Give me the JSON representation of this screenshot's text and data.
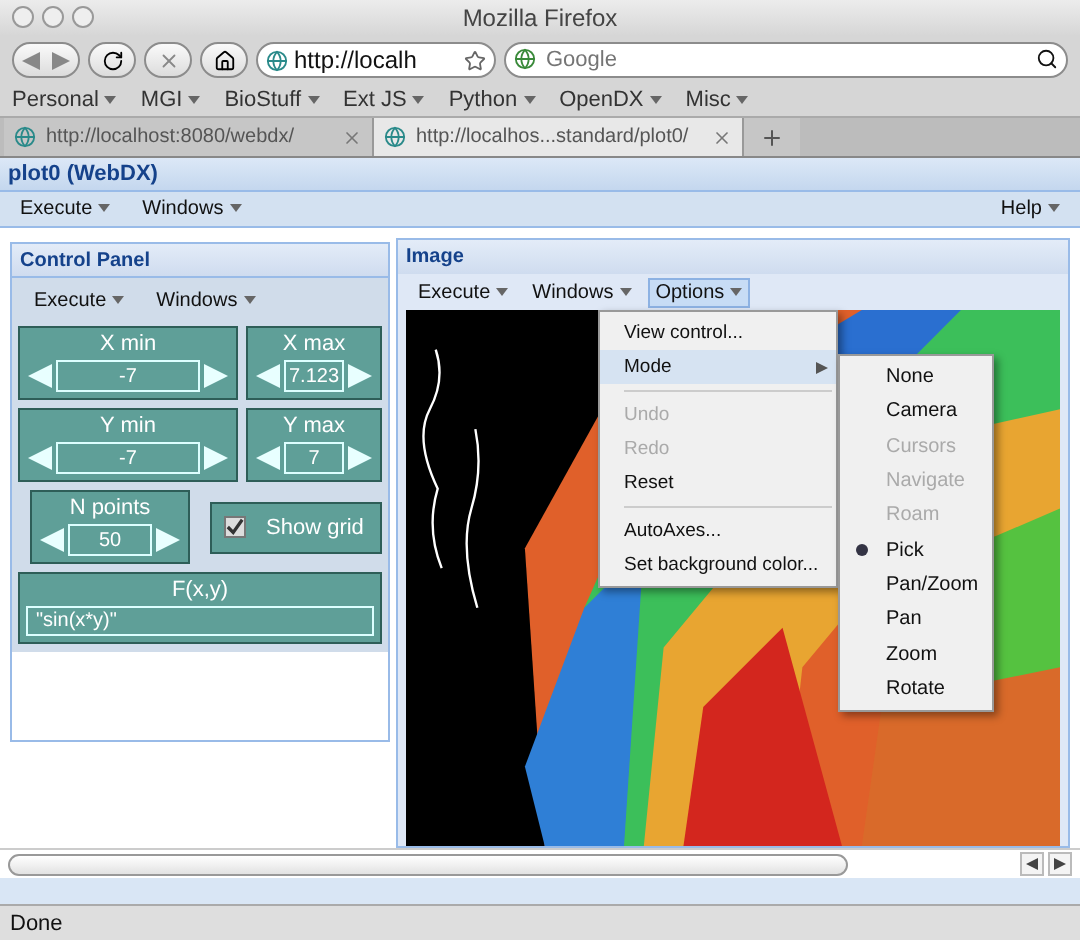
{
  "window": {
    "title": "Mozilla Firefox"
  },
  "toolbar": {
    "url": "http://localh",
    "search": {
      "placeholder": "Google"
    }
  },
  "bookmarks": [
    {
      "label": "Personal"
    },
    {
      "label": "MGI"
    },
    {
      "label": "BioStuff"
    },
    {
      "label": "Ext JS"
    },
    {
      "label": "Python"
    },
    {
      "label": "OpenDX"
    },
    {
      "label": "Misc"
    }
  ],
  "tabs": [
    {
      "label": "http://localhost:8080/webdx/",
      "selected": false
    },
    {
      "label": "http://localhos...standard/plot0/",
      "selected": true
    }
  ],
  "app": {
    "title": "plot0 (WebDX)",
    "menu": [
      "Execute",
      "Windows"
    ],
    "help": "Help"
  },
  "control_panel": {
    "title": "Control Panel",
    "menu": [
      "Execute",
      "Windows"
    ],
    "spinners": [
      {
        "label": "X min",
        "value": "-7"
      },
      {
        "label": "X max",
        "value": "7.123"
      },
      {
        "label": "Y min",
        "value": "-7"
      },
      {
        "label": "Y max",
        "value": "7"
      }
    ],
    "n_points": {
      "label": "N points",
      "value": "50"
    },
    "show_grid": {
      "label": "Show grid",
      "checked": true
    },
    "function": {
      "label": "F(x,y)",
      "value": "\"sin(x*y)\""
    }
  },
  "image_panel": {
    "title": "Image",
    "menu": [
      {
        "label": "Execute",
        "selected": false
      },
      {
        "label": "Windows",
        "selected": false
      },
      {
        "label": "Options",
        "selected": true
      }
    ],
    "options_menu": [
      {
        "kind": "item",
        "label": "View control...",
        "disabled": false,
        "expanded": false
      },
      {
        "kind": "submenu",
        "label": "Mode",
        "disabled": false,
        "expanded": true
      },
      {
        "kind": "separator"
      },
      {
        "kind": "item",
        "label": "Undo",
        "disabled": true,
        "expanded": false
      },
      {
        "kind": "item",
        "label": "Redo",
        "disabled": true,
        "expanded": false
      },
      {
        "kind": "item",
        "label": "Reset",
        "disabled": false,
        "expanded": false
      },
      {
        "kind": "separator"
      },
      {
        "kind": "item",
        "label": "AutoAxes...",
        "disabled": false,
        "expanded": false
      },
      {
        "kind": "item",
        "label": "Set background color...",
        "disabled": false,
        "expanded": false
      }
    ],
    "mode_menu": [
      {
        "label": "None",
        "selected": false,
        "disabled": false
      },
      {
        "label": "Camera",
        "selected": false,
        "disabled": false
      },
      {
        "label": "Cursors",
        "selected": false,
        "disabled": true
      },
      {
        "label": "Navigate",
        "selected": false,
        "disabled": true
      },
      {
        "label": "Roam",
        "selected": false,
        "disabled": true
      },
      {
        "label": "Pick",
        "selected": true,
        "disabled": false
      },
      {
        "label": "Pan/Zoom",
        "selected": false,
        "disabled": false
      },
      {
        "label": "Pan",
        "selected": false,
        "disabled": false
      },
      {
        "label": "Zoom",
        "selected": false,
        "disabled": false
      },
      {
        "label": "Rotate",
        "selected": false,
        "disabled": false
      }
    ]
  },
  "status_bar": {
    "text": "Done"
  }
}
